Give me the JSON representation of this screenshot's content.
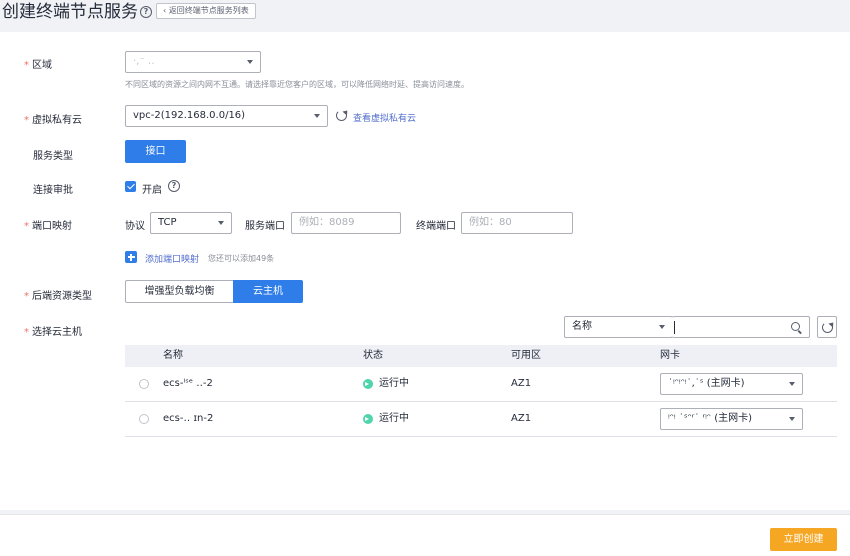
{
  "header": {
    "title": "创建终端节点服务",
    "back_label": "返回终端节点服务列表"
  },
  "form": {
    "region": {
      "label": "区域",
      "value": "·,⁻ ‥",
      "hint": "不同区域的资源之间内网不互通。请选择靠近您客户的区域，可以降低网络时延、提高访问速度。"
    },
    "vpc": {
      "label": "虚拟私有云",
      "value": "vpc-2(192.168.0.0/16)",
      "link": "查看虚拟私有云"
    },
    "service_type": {
      "label": "服务类型",
      "value": "接口"
    },
    "approval": {
      "label": "连接审批",
      "checkbox_label": "开启"
    },
    "port_mapping": {
      "label": "端口映射",
      "protocol_label": "协议",
      "protocol_value": "TCP",
      "service_port_label": "服务端口",
      "service_port_placeholder": "例如：8089",
      "terminal_port_label": "终端端口",
      "terminal_port_placeholder": "例如：80",
      "add_link": "添加端口映射",
      "add_hint": "您还可以添加49条"
    },
    "backend_type": {
      "label": "后端资源类型",
      "options": [
        "增强型负载均衡",
        "云主机"
      ],
      "selected": "云主机"
    },
    "host_select": {
      "label": "选择云主机",
      "filter_value": "名称",
      "columns": [
        "名称",
        "状态",
        "可用区",
        "网卡"
      ],
      "rows": [
        {
          "name": "ecs-ˡˢᵉ ‥-2",
          "status": "运行中",
          "zone": "AZ1",
          "nic": "˙ᵎᵔᵎᵔᵎ˙,˙ˢ (主网卡)"
        },
        {
          "name": "ecs-‥ ɪn-2",
          "status": "运行中",
          "zone": "AZ1",
          "nic": "ᵎᵔᵎ ˙ˢᵔʳ˙ ʳᵎᵔ (主网卡)"
        }
      ]
    }
  },
  "footer": {
    "create_label": "立即创建"
  },
  "colors": {
    "primary": "#2e7de9",
    "required": "#f66f6a",
    "running": "#50d4ab",
    "submit": "#f5a623"
  }
}
